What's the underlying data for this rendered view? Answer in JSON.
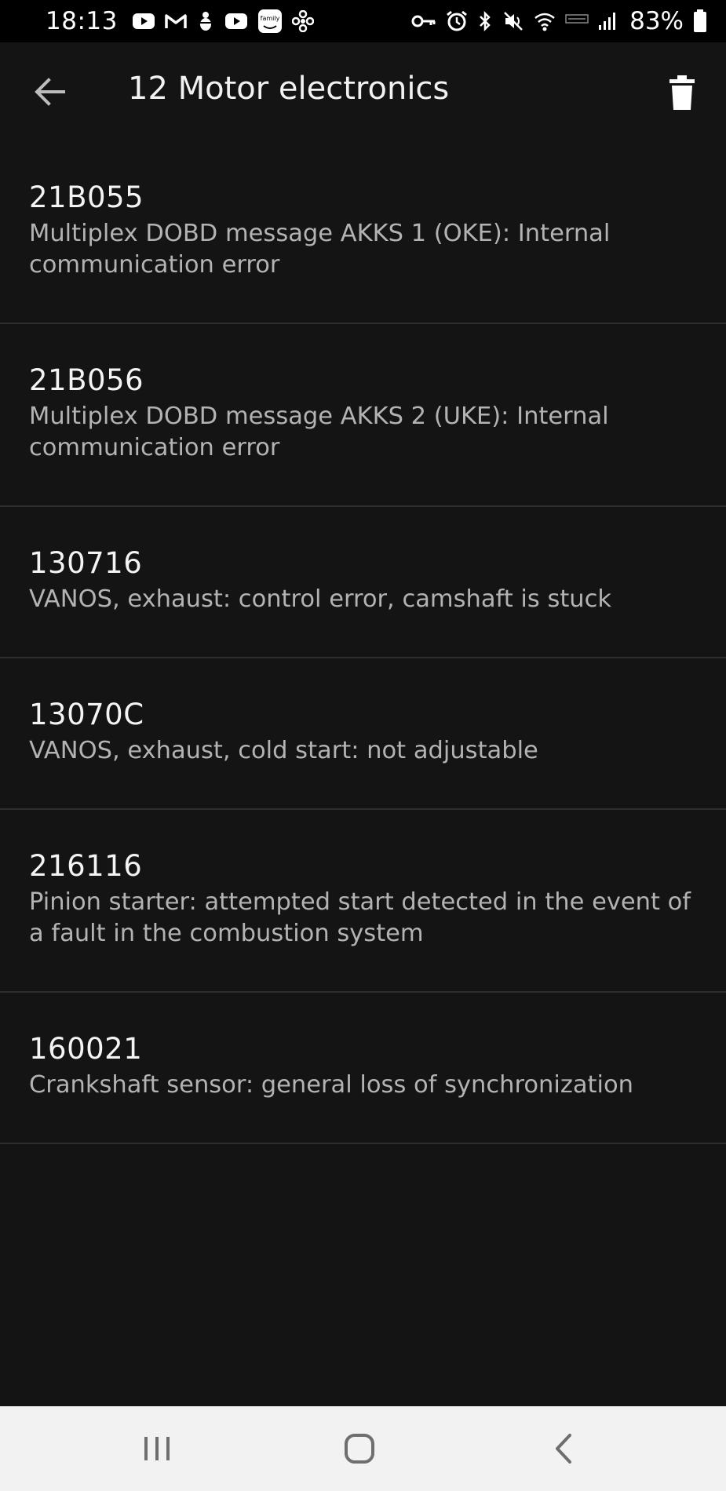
{
  "status_bar": {
    "time": "18:13",
    "battery_percent": "83%",
    "notification_icons": [
      "youtube-icon",
      "gmail-icon",
      "bug-icon",
      "youtube-icon",
      "family-app-icon",
      "fan-icon"
    ],
    "system_icons": [
      "vpn-key-icon",
      "alarm-icon",
      "bluetooth-icon",
      "mute-icon",
      "wifi-icon",
      "volte-icon",
      "signal-icon",
      "battery-icon"
    ],
    "family_badge_text": "family"
  },
  "app_bar": {
    "title": "12 Motor electronics",
    "back_icon": "arrow-back-icon",
    "delete_icon": "trash-icon"
  },
  "faults": [
    {
      "code": "21B055",
      "description": "Multiplex DOBD message AKKS 1 (OKE): Internal communication error"
    },
    {
      "code": "21B056",
      "description": "Multiplex DOBD message AKKS 2 (UKE): Internal communication error"
    },
    {
      "code": "130716",
      "description": "VANOS, exhaust: control error, camshaft is stuck"
    },
    {
      "code": "13070C",
      "description": "VANOS, exhaust, cold start: not adjustable"
    },
    {
      "code": "216116",
      "description": "Pinion starter: attempted start detected in the event of a fault in the combustion system"
    },
    {
      "code": "160021",
      "description": "Crankshaft sensor: general loss of synchronization"
    }
  ],
  "nav_bar": {
    "recents_icon": "recents-icon",
    "home_icon": "home-icon",
    "back_icon": "nav-back-icon"
  },
  "colors": {
    "background": "#141414",
    "status_bar": "#000000",
    "divider": "#2e2e2e",
    "code_text": "#f4f4f4",
    "description_text": "#b3b3b3",
    "nav_bar": "#f2f2f2"
  }
}
